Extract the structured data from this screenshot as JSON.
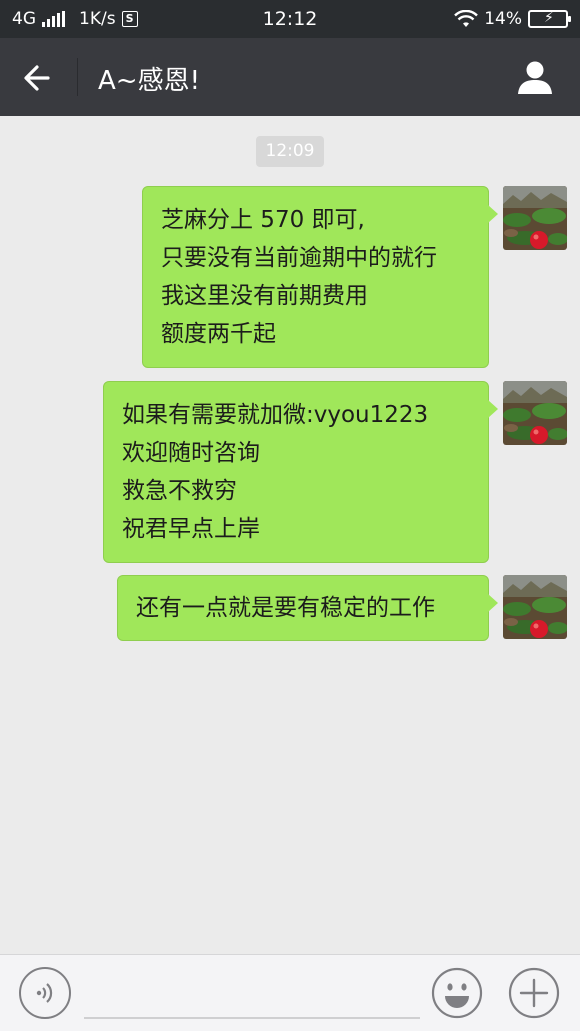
{
  "status_bar": {
    "network": "4G",
    "speed": "1K/s",
    "speed_icon": "S",
    "time": "12:12",
    "battery": "14%"
  },
  "header": {
    "title": "A~感恩!",
    "back_icon": "arrow-left-icon",
    "profile_icon": "person-icon"
  },
  "chat": {
    "timestamp": "12:09",
    "messages": [
      {
        "lines": [
          "芝麻分上 570 即可,",
          "只要没有当前逾期中的就行",
          "我这里没有前期费用",
          "额度两千起"
        ]
      },
      {
        "lines": [
          "如果有需要就加微:vyou1223",
          "欢迎随时咨询",
          "救急不救穷",
          "祝君早点上岸"
        ]
      },
      {
        "lines": [
          "还有一点就是要有稳定的工作"
        ]
      }
    ]
  },
  "input_bar": {
    "input_value": "",
    "voice_icon": "voice-icon",
    "emoji_icon": "emoji-icon",
    "plus_icon": "plus-icon"
  },
  "colors": {
    "bubble": "#a0e75a",
    "nav": "#393a3f",
    "status": "#2a2d30",
    "background": "#ebebeb"
  }
}
